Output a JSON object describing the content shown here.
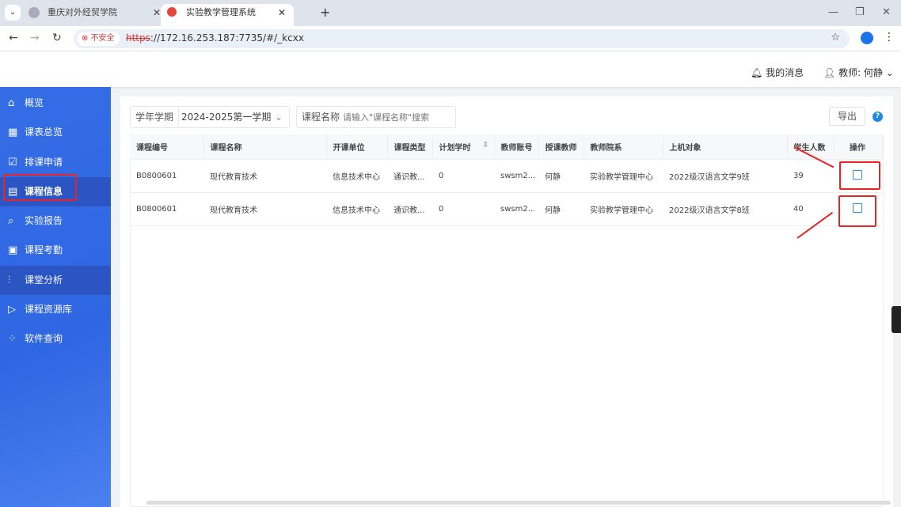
{
  "browser": {
    "tabs": [
      {
        "title": "重庆对外经贸学院"
      },
      {
        "title": "实验教学管理系统"
      }
    ],
    "insecure_label": "不安全",
    "url_scheme": "https",
    "url_rest": "://172.16.253.187:7735/#/_kcxx"
  },
  "header": {
    "messages": "我的消息",
    "user": "教师: 何静"
  },
  "sidebar": {
    "items": [
      {
        "label": "概览",
        "icon": "⌂"
      },
      {
        "label": "课表总览",
        "icon": "▦"
      },
      {
        "label": "排课申请",
        "icon": "☑"
      },
      {
        "label": "课程信息",
        "icon": "▤"
      },
      {
        "label": "实验报告",
        "icon": "⌕"
      },
      {
        "label": "课程考勤",
        "icon": "▣"
      },
      {
        "label": "课堂分析",
        "icon": "⫶"
      },
      {
        "label": "课程资源库",
        "icon": "▷"
      },
      {
        "label": "软件查询",
        "icon": "⁘"
      }
    ]
  },
  "filters": {
    "term_label": "学年学期",
    "term_value": "2024-2025第一学期",
    "course_label": "课程名称",
    "course_placeholder": "请输入\"课程名称\"搜索"
  },
  "toolbar": {
    "export": "导出",
    "help": "?"
  },
  "table": {
    "headers": [
      "课程编号",
      "课程名称",
      "开课单位",
      "课程类型",
      "计划学时",
      "教师账号",
      "授课教师",
      "教师院系",
      "上机对象",
      "学生人数",
      "操作"
    ],
    "rows": [
      [
        "B0800601",
        "现代教育技术",
        "信息技术中心",
        "通识教...",
        "0",
        "swsm2...",
        "何静",
        "实验教学管理中心",
        "2022级汉语言文学9班",
        "39"
      ],
      [
        "B0800601",
        "现代教育技术",
        "信息技术中心",
        "通识教...",
        "0",
        "swsm2...",
        "何静",
        "实验教学管理中心",
        "2022级汉语言文学8班",
        "40"
      ]
    ]
  }
}
